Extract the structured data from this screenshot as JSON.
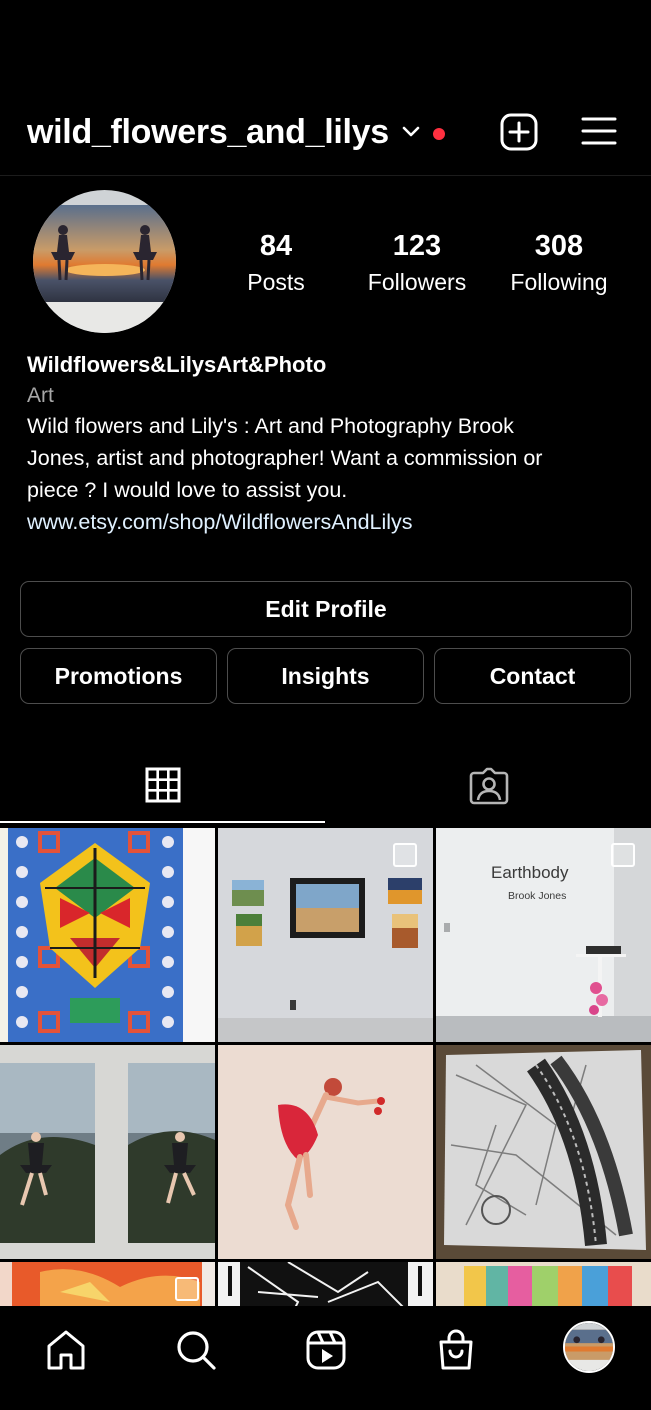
{
  "header": {
    "username": "wild_flowers_and_lilys",
    "icons": [
      "chevron-down-icon",
      "notification-dot",
      "create-icon",
      "menu-icon"
    ],
    "dot_color": "#ff3040"
  },
  "profile": {
    "stats": [
      {
        "value": "84",
        "label": "Posts"
      },
      {
        "value": "123",
        "label": "Followers"
      },
      {
        "value": "308",
        "label": "Following"
      }
    ],
    "display_name": "Wildflowers&LilysArt&Photo",
    "category": "Art",
    "bio_lines": [
      "Wild flowers and Lily's : Art and Photography Brook",
      "Jones, artist and photographer! Want a commission or",
      "piece ? I would love to assist you."
    ],
    "link": "www.etsy.com/shop/WildflowersAndLilys"
  },
  "actions": {
    "edit_profile": "Edit Profile",
    "promotions": "Promotions",
    "insights": "Insights",
    "contact": "Contact"
  },
  "tabs": [
    {
      "icon": "grid-icon",
      "active": true
    },
    {
      "icon": "tagged-icon",
      "active": false
    }
  ],
  "posts": [
    {
      "subject": "geometric mask painting"
    },
    {
      "subject": "gallery wall with paintings",
      "multi": true
    },
    {
      "subject": "Earthbody exhibit wall",
      "multi": true,
      "sign_title": "Earthbody",
      "sign_sub": "Brook Jones"
    },
    {
      "subject": "dancer photographs on wall"
    },
    {
      "subject": "ballerina watercolor"
    },
    {
      "subject": "black and white aerial map collage"
    },
    {
      "subject": "colorful painting",
      "multi": true
    },
    {
      "subject": "black and white drawing"
    },
    {
      "subject": "rainbow painting"
    }
  ],
  "nav": {
    "icons": [
      "home-icon",
      "search-icon",
      "reels-icon",
      "shop-icon",
      "profile-avatar"
    ]
  },
  "colors": {
    "background": "#000000",
    "text": "#ffffff",
    "secondary_text": "#a8a8a8",
    "link": "#e0f1ff",
    "button_border": "#4d4d4d"
  }
}
